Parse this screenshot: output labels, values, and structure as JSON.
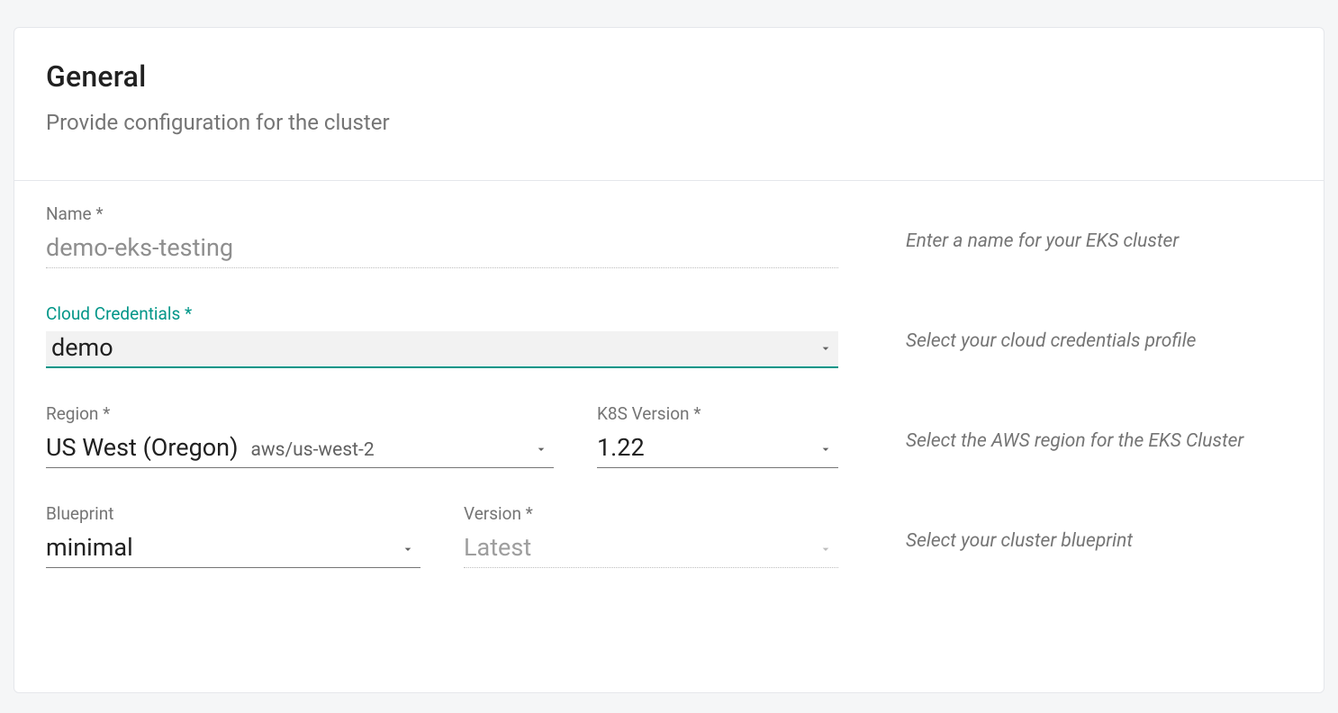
{
  "header": {
    "title": "General",
    "subtitle": "Provide configuration for the cluster"
  },
  "fields": {
    "name": {
      "label": "Name *",
      "value": "demo-eks-testing",
      "help": "Enter a name for your EKS cluster"
    },
    "credentials": {
      "label": "Cloud Credentials *",
      "value": "demo",
      "help": "Select your cloud credentials profile"
    },
    "region": {
      "label": "Region *",
      "value": "US West (Oregon)",
      "code": "aws/us-west-2",
      "help": "Select the AWS region for the EKS Cluster"
    },
    "k8s_version": {
      "label": "K8S Version *",
      "value": "1.22"
    },
    "blueprint": {
      "label": "Blueprint",
      "value": "minimal",
      "help": "Select your cluster blueprint"
    },
    "bp_version": {
      "label": "Version *",
      "value": "Latest"
    }
  }
}
